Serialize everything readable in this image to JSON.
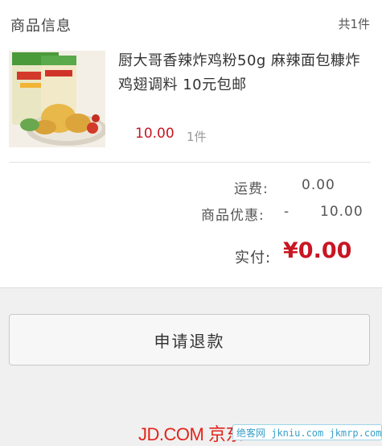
{
  "section": {
    "title": "商品信息",
    "count": "共1件"
  },
  "product": {
    "name": "厨大哥香辣炸鸡粉50g 麻辣面包糠炸鸡翅调料 10元包邮",
    "price": "10.00",
    "quantity": "1件",
    "thumbnail_icon": "product-thumbnail"
  },
  "summary": {
    "freight_label": "运费:",
    "freight_value": "0.00",
    "discount_label": "商品优惠:",
    "discount_sign": "-",
    "discount_value": "10.00",
    "paid_label": "实付:",
    "paid_value": "¥0.00"
  },
  "actions": {
    "refund_label": "申请退款"
  },
  "footer": {
    "logo_text": "JD.COM 京东",
    "watermark": "绝客网 jkniu.com jkmrp.com"
  },
  "colors": {
    "accent": "#c81623",
    "background": "#f0f0f0"
  }
}
